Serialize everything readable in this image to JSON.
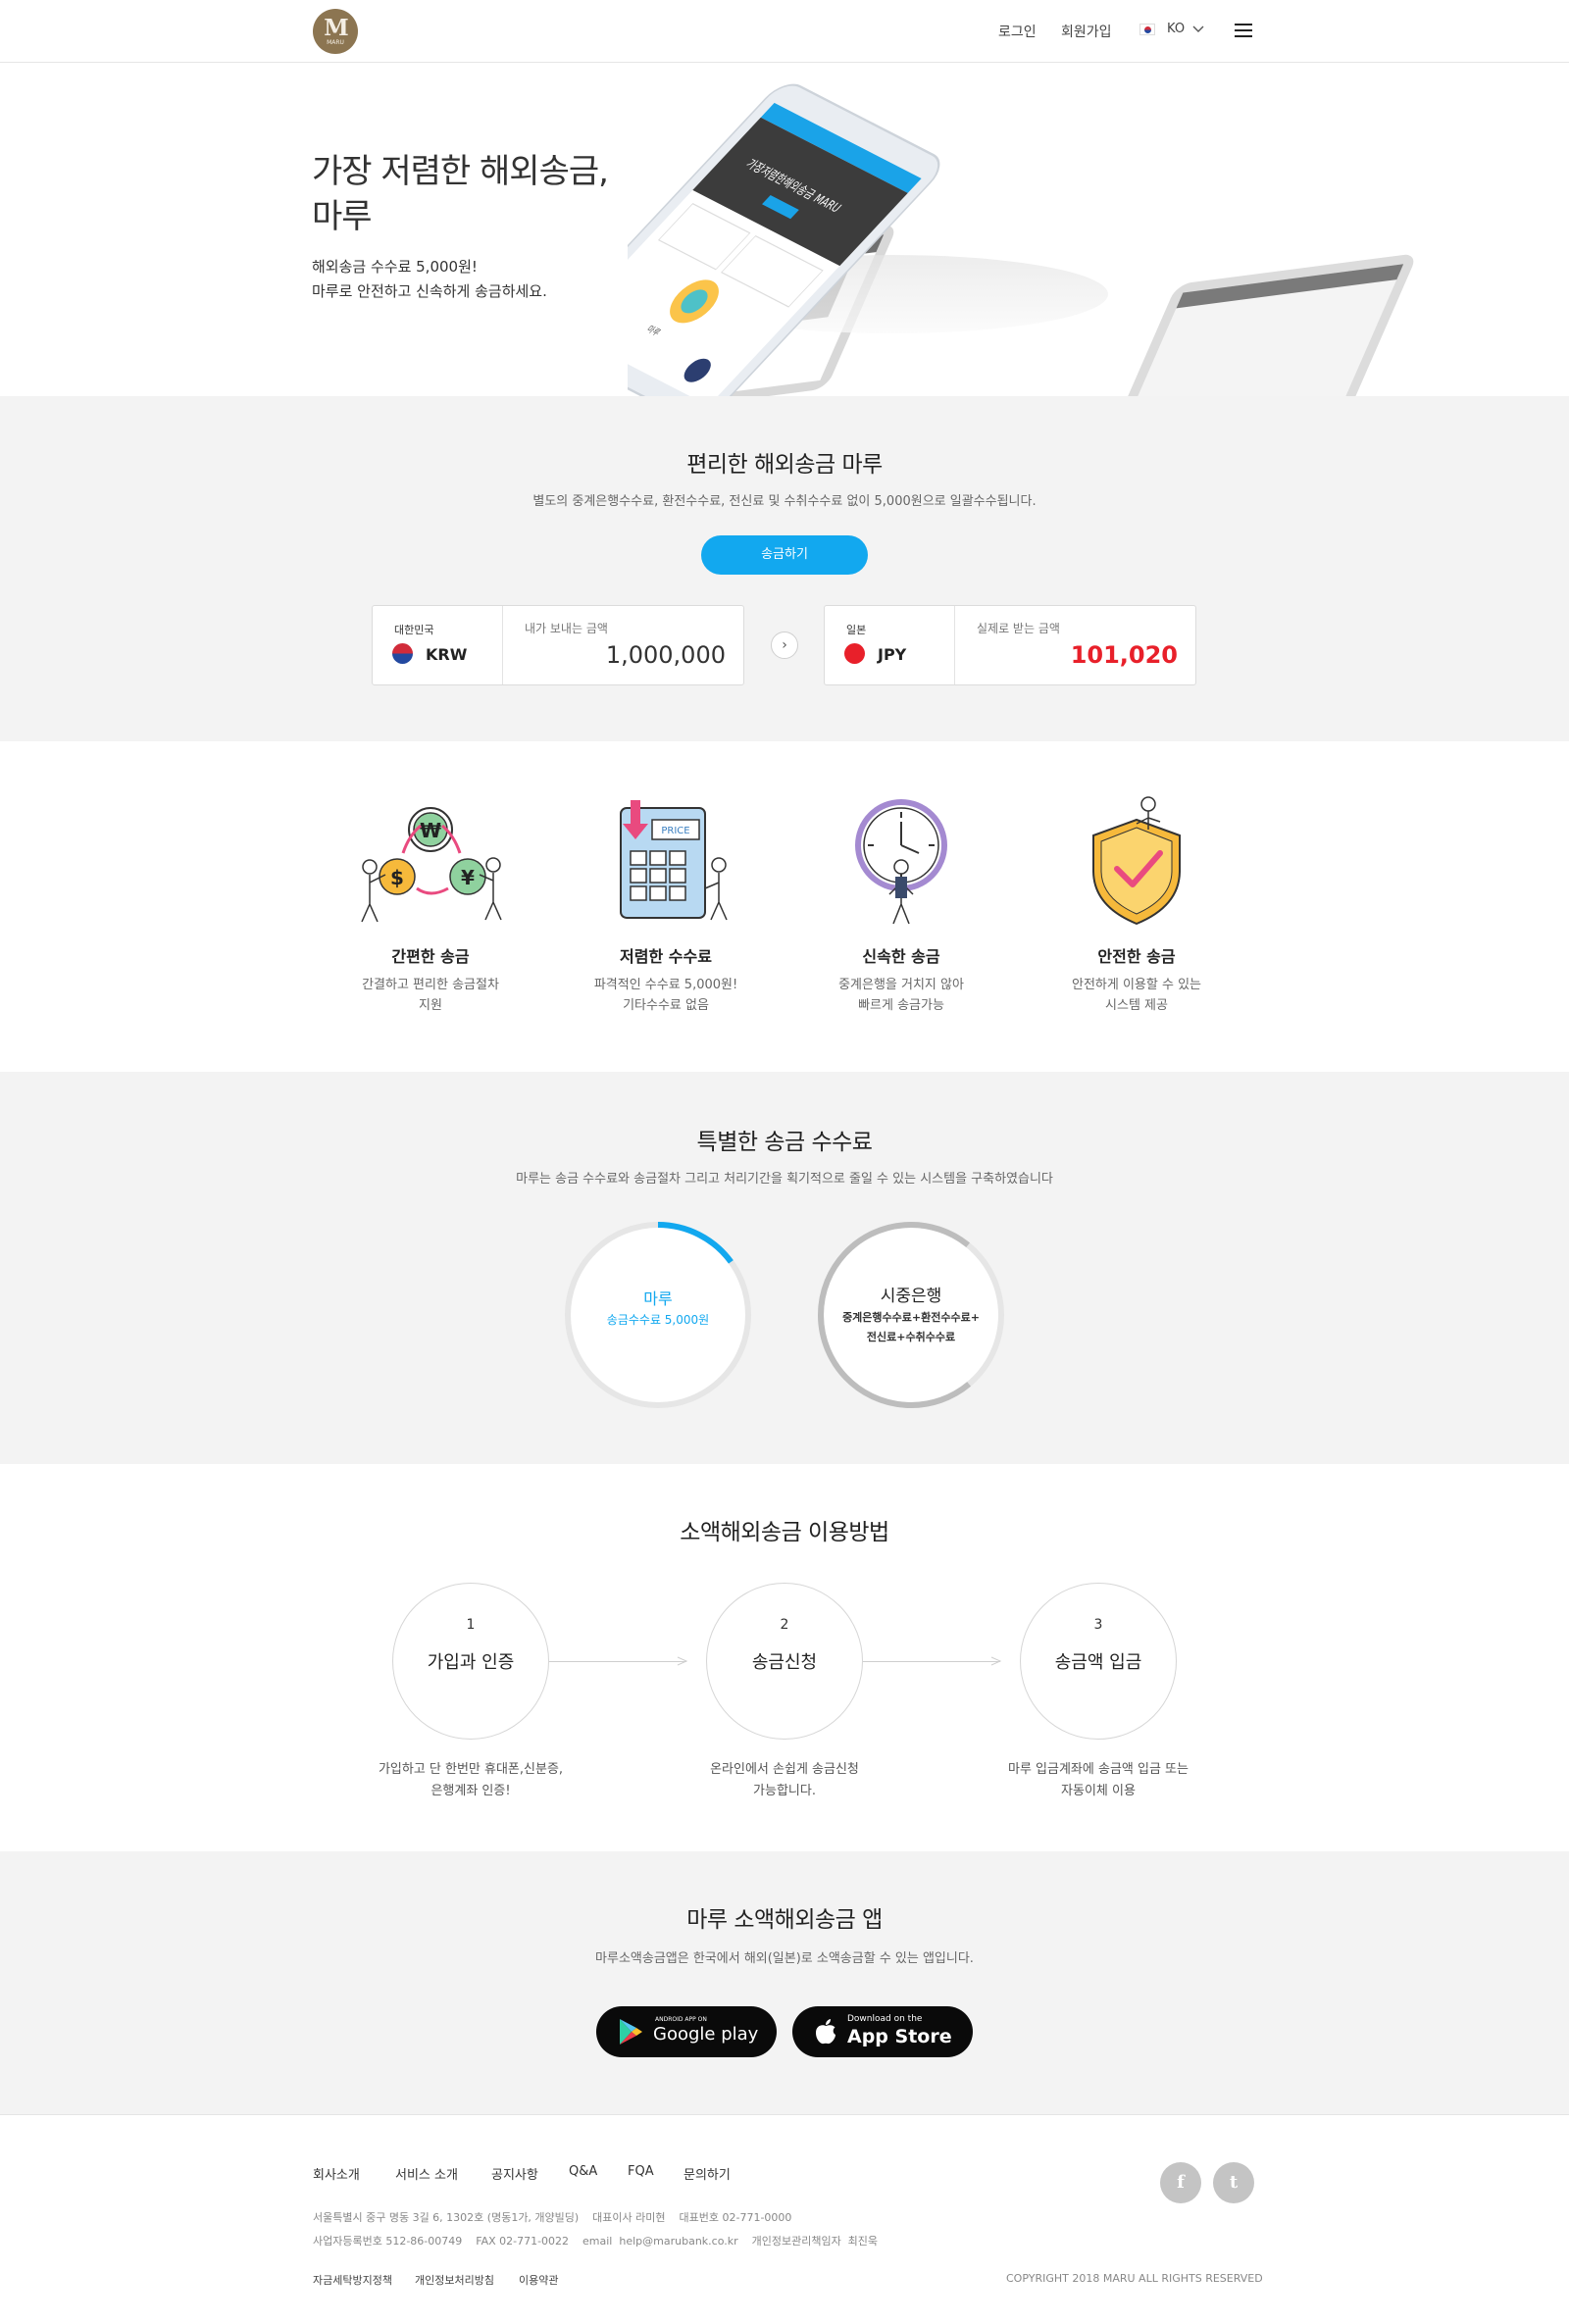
{
  "header": {
    "logo_text": "M",
    "logo_sub": "MARU",
    "login": "로그인",
    "signup": "회원가입",
    "lang": "KO",
    "lang_icon": "korea-flag-icon",
    "menu_icon": "hamburger-menu-icon"
  },
  "hero": {
    "title_line1": "가장 저렴한 해외송금,",
    "title_line2": "마루",
    "sub_line1": "해외송금 수수료 5,000원!",
    "sub_line2": "마루로 안전하고 신속하게 송금하세요.",
    "phone_text1": "가장저렴한해외송금 MARU",
    "phone_text2": "마루"
  },
  "calculator": {
    "title": "편리한 해외송금 마루",
    "desc": "별도의 중계은행수수료, 환전수수료, 전신료 및 수취수수료 없이 5,000원으로 일괄수수됩니다.",
    "button": "송금하기",
    "send": {
      "country": "대한민국",
      "currency": "KRW",
      "label": "내가 보내는 금액",
      "amount": "1,000,000"
    },
    "receive": {
      "country": "일본",
      "currency": "JPY",
      "label": "실제로 받는 금액",
      "amount": "101,020"
    },
    "accent_color": "#12a8ef",
    "receive_color": "#e8202a"
  },
  "features": [
    {
      "icon": "currency-exchange-icon",
      "title": "간편한 송금",
      "desc1": "간결하고 편리한 송금절차",
      "desc2": "지원"
    },
    {
      "icon": "calculator-price-icon",
      "title": "저렴한 수수료",
      "desc1": "파격적인 수수료 5,000원!",
      "desc2": "기타수수료 없음"
    },
    {
      "icon": "clock-icon",
      "title": "신속한 송금",
      "desc1": "중계은행을 거치지 않아",
      "desc2": "빠르게 송금가능"
    },
    {
      "icon": "shield-check-icon",
      "title": "안전한 송금",
      "desc1": "안전하게 이용할 수 있는",
      "desc2": "시스템 제공"
    }
  ],
  "feature_art": {
    "price_tag": "PRICE",
    "won": "₩",
    "dollar": "$",
    "yen": "¥"
  },
  "fee": {
    "title": "특별한 송금 수수료",
    "desc": "마루는 송금 수수료와 송금절차 그리고 처리기간을 획기적으로 줄일 수 있는 시스템을 구축하였습니다",
    "maru": {
      "name": "마루",
      "detail": "송금수수료 5,000원",
      "fill": 0.15
    },
    "bank": {
      "name": "시중은행",
      "detail1": "중계은행수수료+환전수수료+",
      "detail2": "전신료+수취수수료",
      "fill": 0.72
    }
  },
  "steps": {
    "title": "소액해외송금 이용방법",
    "items": [
      {
        "num": "1",
        "label": "가입과 인증",
        "desc1": "가입하고 단 한번만 휴대폰,신분증,",
        "desc2": "은행계좌 인증!"
      },
      {
        "num": "2",
        "label": "송금신청",
        "desc1": "온라인에서 손쉽게 송금신청",
        "desc2": "가능합니다."
      },
      {
        "num": "3",
        "label": "송금액 입금",
        "desc1": "마루 입금계좌에 송금액 입금 또는",
        "desc2": "자동이체 이용"
      }
    ]
  },
  "app": {
    "title": "마루 소액해외송금 앱",
    "desc": "마루소액송금앱은 한국에서 해외(일본)로 소액송금할 수 있는 앱입니다.",
    "google_small": "ANDROID APP ON",
    "google_big": "Google play",
    "apple_small": "Download on the",
    "apple_big": "App Store"
  },
  "footer": {
    "links": [
      "회사소개",
      "서비스 소개",
      "공지사항",
      "Q&A",
      "FQA",
      "문의하기"
    ],
    "info1": "서울특별시 중구 명동 3길 6, 1302호 (명동1가, 개양빌딩)    대표이사 라미현    대표번호 02-771-0000",
    "info2": "사업자등록번호 512-86-00749    FAX 02-771-0022    email  help@marubank.co.kr    개인정보관리책임자  최진욱",
    "bottom": [
      "자금세탁방지정책",
      "개인정보처리방침",
      "이용약관"
    ],
    "copyright": "COPYRIGHT 2018 MARU ALL RIGHTS RESERVED",
    "facebook": "f",
    "twitter": "t"
  }
}
